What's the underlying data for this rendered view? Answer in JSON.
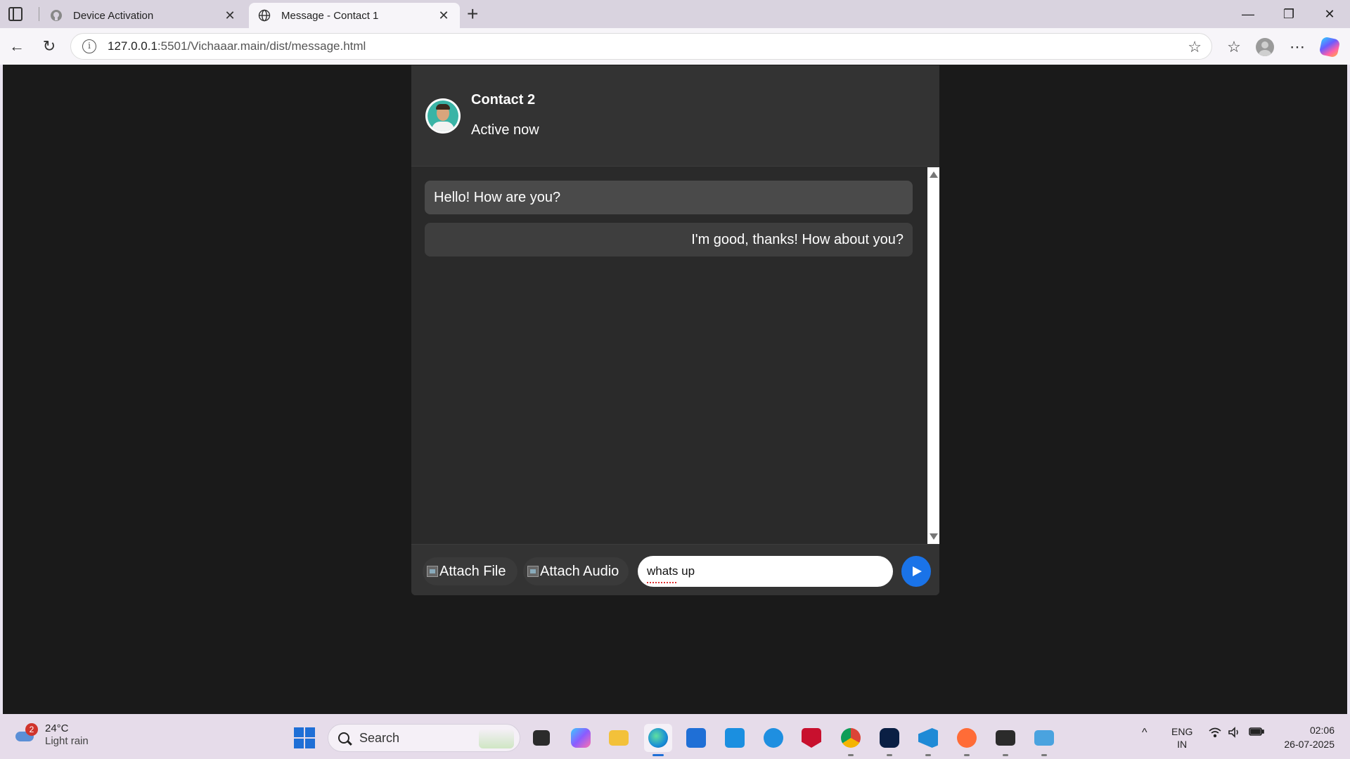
{
  "browser": {
    "tabs": [
      {
        "title": "Device Activation",
        "favicon": "github-icon",
        "active": false
      },
      {
        "title": "Message - Contact 1",
        "favicon": "globe-icon",
        "active": true
      }
    ],
    "url_host": "127.0.0.1",
    "url_path": ":5501/Vichaaar.main/dist/message.html"
  },
  "chat": {
    "contact_name": "Contact 2",
    "contact_status": "Active now",
    "messages": [
      {
        "text": "Hello! How are you?",
        "direction": "received"
      },
      {
        "text": "I'm good, thanks! How about you?",
        "direction": "sent"
      }
    ],
    "attach_file_label": "Attach File",
    "attach_audio_label": "Attach Audio",
    "input_value": "whats up"
  },
  "colors": {
    "page_bg": "#1a1a1a",
    "header_bg": "#333333",
    "send_button": "#1a73e8"
  },
  "taskbar": {
    "weather_temp": "24°C",
    "weather_desc": "Light rain",
    "weather_badge": "2",
    "search_label": "Search",
    "lang_line1": "ENG",
    "lang_line2": "IN",
    "time": "02:06",
    "date": "26-07-2025",
    "apps": [
      "file-explorer-icon",
      "copilot-icon",
      "folder-icon",
      "edge-icon",
      "store-icon",
      "myhp-icon",
      "help-icon",
      "mcafee-icon",
      "chrome-icon",
      "webex-icon",
      "vscode-icon",
      "postman-icon",
      "terminal-icon",
      "control-panel-icon"
    ]
  }
}
